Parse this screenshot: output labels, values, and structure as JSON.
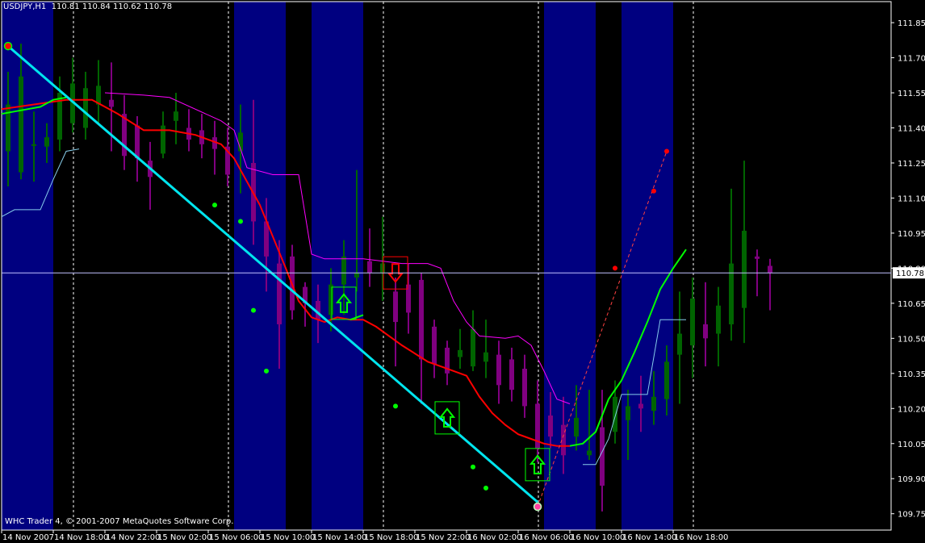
{
  "header": {
    "symbol": "USDJPY,H1",
    "ohlc": "110.81 110.84 110.62 110.78"
  },
  "footer": {
    "copyright": "WHC Trader 4, © 2001-2007 MetaQuotes Software Corp."
  },
  "colors": {
    "background": "#000000",
    "axis_text": "#ffffff",
    "session_band": "#000080",
    "bull_candle": "#006400",
    "bear_candle": "#800080",
    "trend_line": "#00e5ee",
    "ma_down": "#ff0000",
    "ma_up": "#00ff00",
    "envelope_upper": "#ff00ff",
    "envelope_lower": "#87ceeb",
    "zigzag": "#ff4040",
    "buy_arrow": "#00ff00",
    "sell_arrow": "#ff0000",
    "price_line": "#c0c0ff"
  },
  "chart_data": {
    "type": "candlestick",
    "symbol": "USDJPY",
    "timeframe": "H1",
    "current_price": "110.78",
    "ylim": [
      109.68,
      111.94
    ],
    "y_ticks": [
      "111.85",
      "111.70",
      "111.55",
      "111.40",
      "111.25",
      "111.10",
      "110.95",
      "110.80",
      "110.65",
      "110.50",
      "110.35",
      "110.20",
      "110.05",
      "109.90",
      "109.75"
    ],
    "x_labels": [
      "14 Nov 2007",
      "14 Nov 18:00",
      "14 Nov 22:00",
      "15 Nov 02:00",
      "15 Nov 06:00",
      "15 Nov 10:00",
      "15 Nov 14:00",
      "15 Nov 18:00",
      "15 Nov 22:00",
      "16 Nov 02:00",
      "16 Nov 06:00",
      "16 Nov 10:00",
      "16 Nov 14:00",
      "16 Nov 18:00"
    ],
    "session_bands": [
      [
        0,
        3
      ],
      [
        18,
        21
      ],
      [
        24,
        27
      ],
      [
        42,
        45
      ],
      [
        48,
        51
      ]
    ],
    "day_separators": [
      5,
      17,
      29,
      41,
      53
    ],
    "candles": [
      {
        "o": 111.3,
        "h": 111.64,
        "l": 111.15,
        "c": 111.5
      },
      {
        "o": 111.21,
        "h": 111.76,
        "l": 111.18,
        "c": 111.62
      },
      {
        "o": 111.33,
        "h": 111.47,
        "l": 111.17,
        "c": 111.33
      },
      {
        "o": 111.32,
        "h": 111.42,
        "l": 111.25,
        "c": 111.36
      },
      {
        "o": 111.35,
        "h": 111.62,
        "l": 111.3,
        "c": 111.55
      },
      {
        "o": 111.42,
        "h": 111.7,
        "l": 111.38,
        "c": 111.59
      },
      {
        "o": 111.4,
        "h": 111.64,
        "l": 111.35,
        "c": 111.57
      },
      {
        "o": 111.5,
        "h": 111.69,
        "l": 111.42,
        "c": 111.58
      },
      {
        "o": 111.52,
        "h": 111.68,
        "l": 111.3,
        "c": 111.49
      },
      {
        "o": 111.46,
        "h": 111.54,
        "l": 111.22,
        "c": 111.28
      },
      {
        "o": 111.41,
        "h": 111.45,
        "l": 111.17,
        "c": 111.27
      },
      {
        "o": 111.26,
        "h": 111.34,
        "l": 111.05,
        "c": 111.19
      },
      {
        "o": 111.29,
        "h": 111.47,
        "l": 111.27,
        "c": 111.41
      },
      {
        "o": 111.43,
        "h": 111.55,
        "l": 111.33,
        "c": 111.47
      },
      {
        "o": 111.4,
        "h": 111.48,
        "l": 111.3,
        "c": 111.35
      },
      {
        "o": 111.39,
        "h": 111.46,
        "l": 111.27,
        "c": 111.33
      },
      {
        "o": 111.36,
        "h": 111.43,
        "l": 111.2,
        "c": 111.31
      },
      {
        "o": 111.32,
        "h": 111.4,
        "l": 111.15,
        "c": 111.2
      },
      {
        "o": 111.3,
        "h": 111.5,
        "l": 111.12,
        "c": 111.38
      },
      {
        "o": 111.25,
        "h": 111.52,
        "l": 110.9,
        "c": 111.0
      },
      {
        "o": 111.0,
        "h": 111.1,
        "l": 110.7,
        "c": 110.85
      },
      {
        "o": 110.82,
        "h": 110.92,
        "l": 110.37,
        "c": 110.56
      },
      {
        "o": 110.85,
        "h": 110.9,
        "l": 110.58,
        "c": 110.62
      },
      {
        "o": 110.72,
        "h": 110.74,
        "l": 110.55,
        "c": 110.65
      },
      {
        "o": 110.66,
        "h": 110.73,
        "l": 110.48,
        "c": 110.58
      },
      {
        "o": 110.6,
        "h": 110.8,
        "l": 110.53,
        "c": 110.73
      },
      {
        "o": 110.73,
        "h": 110.92,
        "l": 110.6,
        "c": 110.85
      },
      {
        "o": 110.76,
        "h": 111.22,
        "l": 110.7,
        "c": 110.78
      },
      {
        "o": 110.83,
        "h": 110.97,
        "l": 110.72,
        "c": 110.78
      },
      {
        "o": 110.78,
        "h": 111.02,
        "l": 110.66,
        "c": 110.82
      },
      {
        "o": 110.7,
        "h": 110.76,
        "l": 110.38,
        "c": 110.57
      },
      {
        "o": 110.73,
        "h": 110.82,
        "l": 110.52,
        "c": 110.61
      },
      {
        "o": 110.75,
        "h": 110.78,
        "l": 110.22,
        "c": 110.41
      },
      {
        "o": 110.55,
        "h": 110.58,
        "l": 110.33,
        "c": 110.39
      },
      {
        "o": 110.46,
        "h": 110.49,
        "l": 110.3,
        "c": 110.35
      },
      {
        "o": 110.42,
        "h": 110.54,
        "l": 110.37,
        "c": 110.45
      },
      {
        "o": 110.38,
        "h": 110.62,
        "l": 110.36,
        "c": 110.54
      },
      {
        "o": 110.4,
        "h": 110.58,
        "l": 110.33,
        "c": 110.44
      },
      {
        "o": 110.43,
        "h": 110.49,
        "l": 110.22,
        "c": 110.3
      },
      {
        "o": 110.41,
        "h": 110.46,
        "l": 110.23,
        "c": 110.28
      },
      {
        "o": 110.37,
        "h": 110.43,
        "l": 110.16,
        "c": 110.21
      },
      {
        "o": 110.22,
        "h": 110.32,
        "l": 109.97,
        "c": 110.03
      },
      {
        "o": 110.17,
        "h": 110.27,
        "l": 110.03,
        "c": 110.08
      },
      {
        "o": 110.13,
        "h": 110.25,
        "l": 109.92,
        "c": 110.0
      },
      {
        "o": 110.08,
        "h": 110.3,
        "l": 110.02,
        "c": 110.16
      },
      {
        "o": 110.0,
        "h": 110.28,
        "l": 109.98,
        "c": 110.02
      },
      {
        "o": 110.12,
        "h": 110.28,
        "l": 109.76,
        "c": 109.87
      },
      {
        "o": 110.1,
        "h": 110.32,
        "l": 110.05,
        "c": 110.25
      },
      {
        "o": 110.15,
        "h": 110.28,
        "l": 109.98,
        "c": 110.21
      },
      {
        "o": 110.22,
        "h": 110.34,
        "l": 110.1,
        "c": 110.2
      },
      {
        "o": 110.19,
        "h": 110.36,
        "l": 110.13,
        "c": 110.25
      },
      {
        "o": 110.24,
        "h": 110.47,
        "l": 110.17,
        "c": 110.4
      },
      {
        "o": 110.43,
        "h": 110.7,
        "l": 110.22,
        "c": 110.52
      },
      {
        "o": 110.47,
        "h": 110.76,
        "l": 110.33,
        "c": 110.67
      },
      {
        "o": 110.56,
        "h": 110.74,
        "l": 110.38,
        "c": 110.5
      },
      {
        "o": 110.52,
        "h": 110.72,
        "l": 110.38,
        "c": 110.64
      },
      {
        "o": 110.56,
        "h": 111.14,
        "l": 110.49,
        "c": 110.82
      },
      {
        "o": 110.63,
        "h": 111.26,
        "l": 110.48,
        "c": 110.96
      },
      {
        "o": 110.85,
        "h": 110.88,
        "l": 110.68,
        "c": 110.84
      },
      {
        "o": 110.81,
        "h": 110.84,
        "l": 110.62,
        "c": 110.78
      }
    ],
    "ma_red": [
      [
        0,
        111.48
      ],
      [
        5,
        111.52
      ],
      [
        7,
        111.52
      ],
      [
        9,
        111.46
      ],
      [
        11,
        111.39
      ],
      [
        13,
        111.39
      ],
      [
        15,
        111.37
      ],
      [
        17,
        111.33
      ],
      [
        18,
        111.27
      ],
      [
        20,
        111.07
      ],
      [
        22,
        110.8
      ],
      [
        23,
        110.66
      ],
      [
        24,
        110.59
      ],
      [
        25,
        110.57
      ],
      [
        26,
        110.59
      ],
      [
        27,
        110.58
      ],
      [
        28,
        110.58
      ],
      [
        29,
        110.55
      ],
      [
        31,
        110.47
      ],
      [
        33,
        110.4
      ],
      [
        34,
        110.38
      ],
      [
        36,
        110.34
      ],
      [
        37,
        110.25
      ],
      [
        38,
        110.18
      ],
      [
        39,
        110.13
      ],
      [
        40,
        110.09
      ],
      [
        41,
        110.07
      ],
      [
        42,
        110.05
      ],
      [
        43,
        110.04
      ],
      [
        44,
        110.04
      ]
    ],
    "ma_green_left": [
      [
        0,
        111.46
      ],
      [
        1,
        111.47
      ],
      [
        2,
        111.48
      ],
      [
        3,
        111.49
      ],
      [
        4,
        111.52
      ],
      [
        5,
        111.53
      ]
    ],
    "ma_green_right": [
      [
        44,
        110.04
      ],
      [
        45,
        110.05
      ],
      [
        46,
        110.1
      ],
      [
        47,
        110.24
      ],
      [
        48,
        110.32
      ],
      [
        49,
        110.44
      ],
      [
        50,
        110.57
      ],
      [
        51,
        110.71
      ],
      [
        52,
        110.8
      ],
      [
        53,
        110.88
      ]
    ],
    "ma_green_mid": [
      [
        27,
        110.58
      ],
      [
        28,
        110.6
      ]
    ],
    "envelope_upper": [
      [
        8,
        111.55
      ],
      [
        11,
        111.54
      ],
      [
        13,
        111.53
      ],
      [
        17,
        111.43
      ],
      [
        18,
        111.39
      ],
      [
        19,
        111.23
      ],
      [
        21,
        111.2
      ],
      [
        23,
        111.2
      ],
      [
        24,
        110.86
      ],
      [
        25,
        110.84
      ],
      [
        27,
        110.84
      ],
      [
        28,
        110.84
      ],
      [
        31,
        110.82
      ],
      [
        33,
        110.82
      ],
      [
        34,
        110.8
      ],
      [
        35,
        110.66
      ],
      [
        36,
        110.57
      ],
      [
        37,
        110.51
      ],
      [
        39,
        110.5
      ],
      [
        40,
        110.51
      ],
      [
        41,
        110.47
      ],
      [
        42,
        110.36
      ],
      [
        43,
        110.24
      ],
      [
        44,
        110.22
      ]
    ],
    "envelope_lower": [
      [
        0,
        111.02
      ],
      [
        1,
        111.05
      ],
      [
        2,
        111.05
      ],
      [
        3,
        111.05
      ],
      [
        4,
        111.18
      ],
      [
        5,
        111.3
      ],
      [
        6,
        111.31
      ]
    ],
    "envelope_lower_right": [
      [
        45,
        109.96
      ],
      [
        46,
        109.96
      ],
      [
        47,
        110.07
      ],
      [
        48,
        110.26
      ],
      [
        49,
        110.26
      ],
      [
        50,
        110.26
      ],
      [
        51,
        110.58
      ],
      [
        52,
        110.58
      ],
      [
        53,
        110.58
      ]
    ],
    "trend_line": [
      [
        0.5,
        111.75
      ],
      [
        41.5,
        109.8
      ]
    ],
    "zigzag": [
      [
        41.5,
        109.78
      ],
      [
        51.5,
        111.3
      ]
    ],
    "zigzag_dots": [
      [
        0.5,
        111.75
      ],
      [
        41.5,
        109.78
      ],
      [
        47.5,
        110.8
      ],
      [
        50.5,
        111.13
      ],
      [
        51.5,
        111.3
      ]
    ],
    "green_dots": [
      [
        16.5,
        111.07
      ],
      [
        18.5,
        111.0
      ],
      [
        19.5,
        110.62
      ],
      [
        20.5,
        110.36
      ],
      [
        30.5,
        110.21
      ],
      [
        36.5,
        109.95
      ],
      [
        37.5,
        109.86
      ]
    ],
    "buy_arrows": [
      [
        26.5,
        110.65
      ],
      [
        34.5,
        110.16
      ],
      [
        41.5,
        109.96
      ]
    ],
    "sell_arrows": [
      [
        30.5,
        110.78
      ]
    ]
  }
}
